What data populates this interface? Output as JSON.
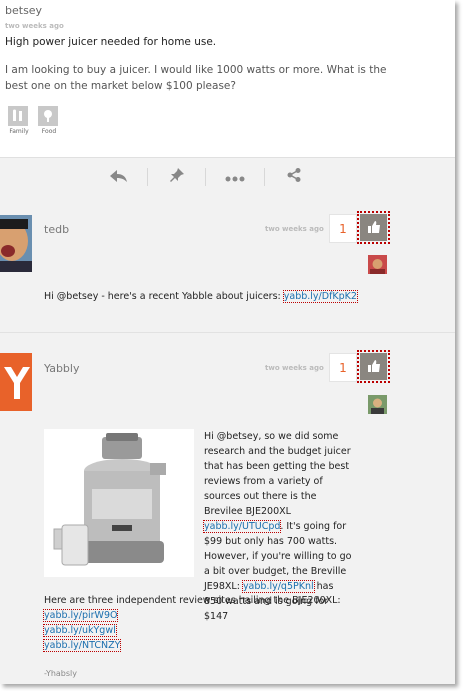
{
  "post": {
    "author": "betsey",
    "time": "two weeks ago",
    "title": "High power juicer needed for home use.",
    "body": "I am looking to buy a juicer. I would like 1000 watts or more. What is the best one on the market below $100 please?",
    "tags": [
      {
        "label": "Family",
        "icon": "family-icon"
      },
      {
        "label": "Food",
        "icon": "food-icon"
      }
    ]
  },
  "actions": [
    {
      "icon": "reply-icon"
    },
    {
      "icon": "pin-icon"
    },
    {
      "icon": "more-icon"
    },
    {
      "icon": "share-icon"
    }
  ],
  "replies": [
    {
      "author": "tedb",
      "time": "two weeks ago",
      "likes": "1",
      "text_before": "Hi @betsey - here's a recent Yabble about juicers:",
      "link": "yabb.ly/DfKpK2"
    },
    {
      "author": "Yabbly",
      "time": "two weeks ago",
      "likes": "1",
      "p1_a": "Hi @betsey, so we did some research and the budget juicer that has been getting the best reviews from a variety of sources out there is the Brevilee BJE200XL",
      "link1": "yabb.ly/UTUCpd",
      "p1_b": ". It's going for $99 but only has 700 watts. However, if you're willing to go a bit over budget, the Breville JE98XL:",
      "link2": "yabb.ly/q5PKnl",
      "p1_c": "has 850 watts and is going for $147",
      "p2": "Here are three independent review sites hailing the BJE200XL:",
      "review_links": [
        "yabb.ly/pirW9O",
        "yabb.ly/ukYgwl",
        "yabb.ly/NTCNZY"
      ],
      "trailing": "-Yhabsly"
    }
  ],
  "colors": {
    "accent": "#e8622a",
    "link": "#1a6fae",
    "like_bg": "#8a8680"
  }
}
